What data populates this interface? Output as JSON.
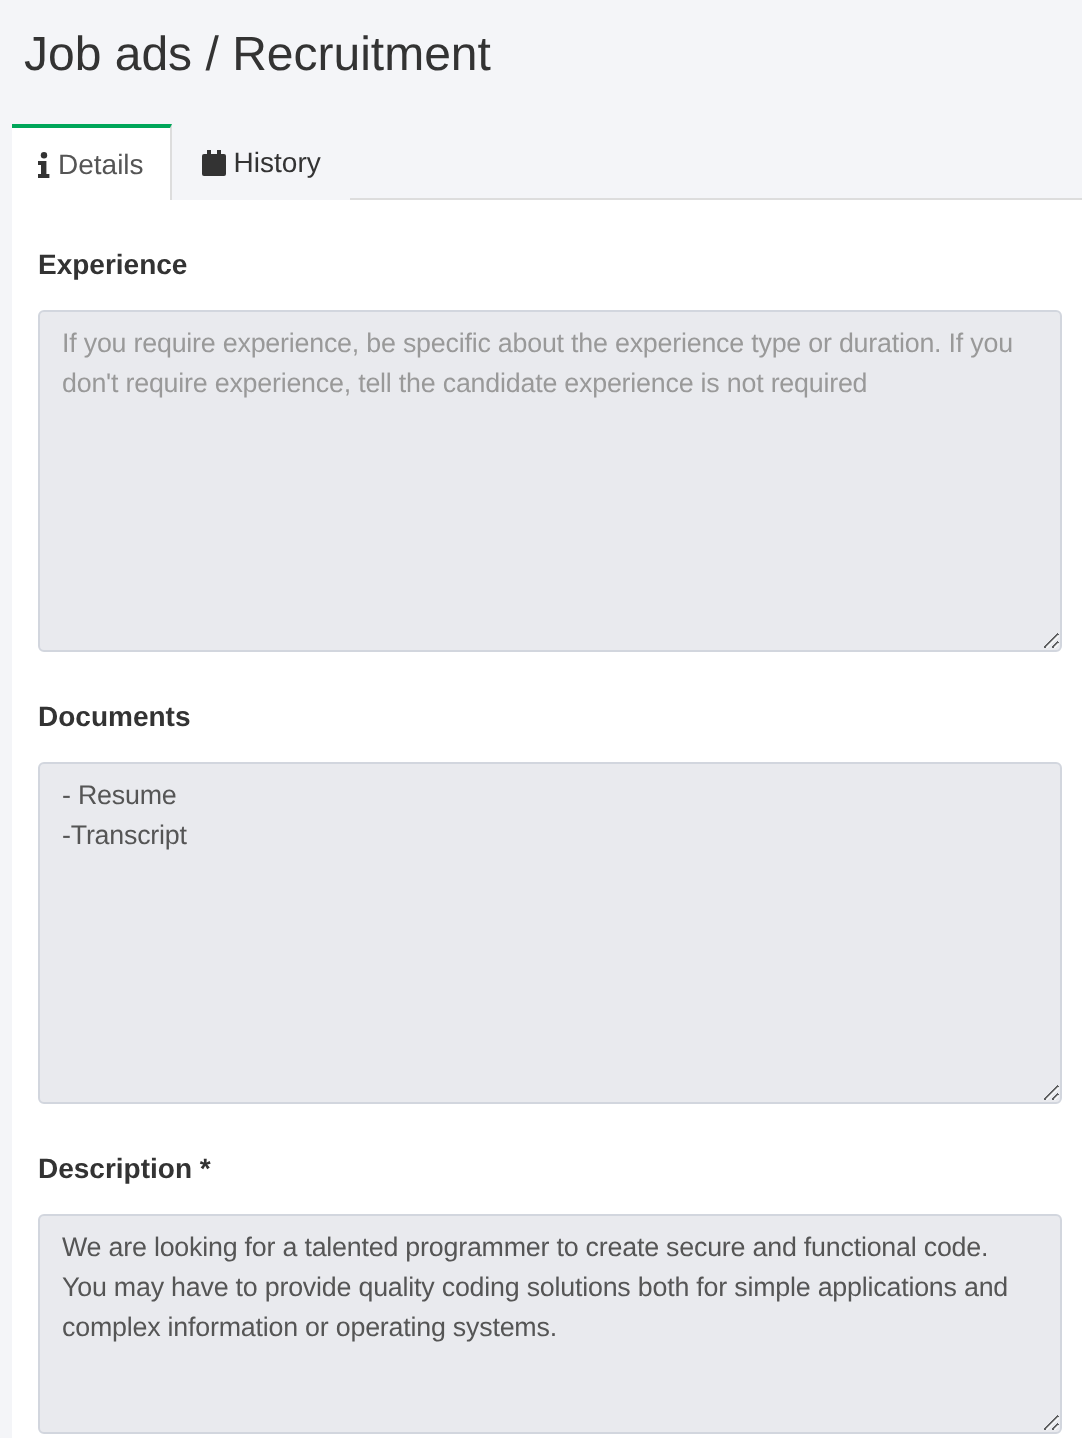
{
  "page_title": "Job ads / Recruitment",
  "tabs": [
    {
      "label": "Details",
      "kind": "info",
      "selected": true
    },
    {
      "label": "History",
      "kind": "calendar",
      "selected": false
    }
  ],
  "fields": [
    {
      "label": "Experience",
      "placeholder": "If you require experience, be specific about the experience type or duration. If you don't require experience, tell the candidate experience is not required",
      "disabled": true
    },
    {
      "label": "Documents",
      "value": "- Resume\n-Transcript",
      "disabled": true
    },
    {
      "label": "Description *",
      "value": "We are looking for a talented programmer to create secure and functional code. You may have to provide quality coding solutions both for simple applications and complex information or operating systems.",
      "disabled": true
    }
  ]
}
